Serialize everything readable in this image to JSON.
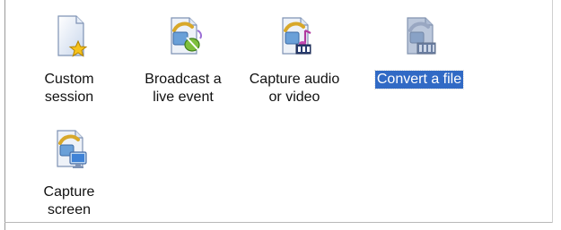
{
  "window": {
    "selection_color": "#316ac5"
  },
  "items": [
    {
      "id": "custom",
      "label": "Custom\nsession",
      "icon": "document-star-icon",
      "selected": false
    },
    {
      "id": "broadcast",
      "label": "Broadcast a\nlive event",
      "icon": "broadcast-event-icon",
      "selected": false
    },
    {
      "id": "capture",
      "label": "Capture audio\nor video",
      "icon": "capture-audio-video-icon",
      "selected": false
    },
    {
      "id": "convert",
      "label": "Convert a file",
      "icon": "convert-file-icon",
      "selected": true
    },
    {
      "id": "screen",
      "label": "Capture\nscreen",
      "icon": "capture-screen-icon",
      "selected": false
    }
  ]
}
